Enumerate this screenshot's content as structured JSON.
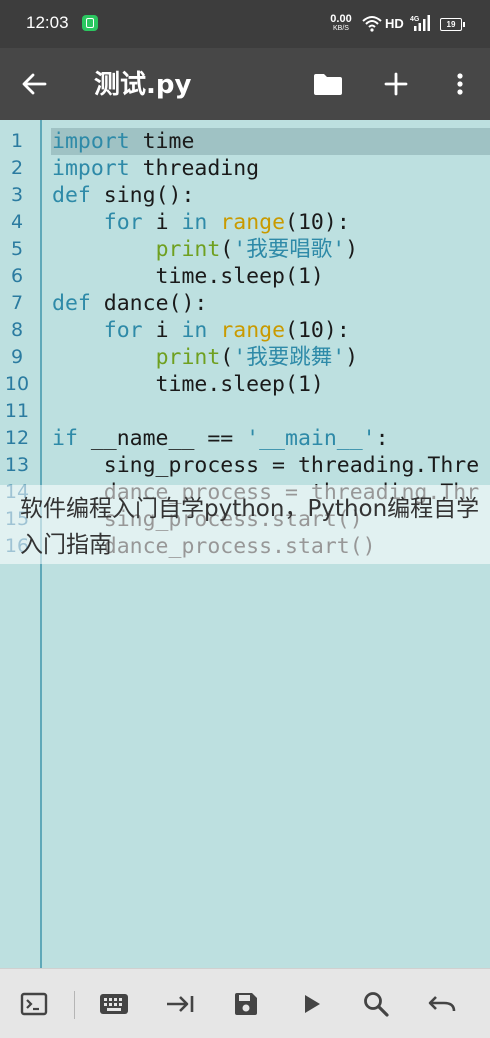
{
  "status_bar": {
    "time": "12:03",
    "net_speed_value": "0.00",
    "net_speed_unit": "KB/S",
    "network_type": "HD",
    "signal_label": "4G",
    "battery_level": "19"
  },
  "app_bar": {
    "title": "测试.py",
    "icons": [
      "back-arrow-icon",
      "folder-icon",
      "add-icon",
      "more-vert-icon"
    ]
  },
  "editor": {
    "current_line": 1,
    "lines": [
      {
        "n": "1",
        "code": "import time"
      },
      {
        "n": "2",
        "code": "import threading"
      },
      {
        "n": "3",
        "code": "def sing():"
      },
      {
        "n": "4",
        "code": "    for i in range(10):"
      },
      {
        "n": "5",
        "code": "        print('我要唱歌')"
      },
      {
        "n": "6",
        "code": "        time.sleep(1)"
      },
      {
        "n": "7",
        "code": "def dance():"
      },
      {
        "n": "8",
        "code": "    for i in range(10):"
      },
      {
        "n": "9",
        "code": "        print('我要跳舞')"
      },
      {
        "n": "10",
        "code": "        time.sleep(1)"
      },
      {
        "n": "11",
        "code": ""
      },
      {
        "n": "12",
        "code": "if __name__ == '__main__':"
      },
      {
        "n": "13",
        "code": "    sing_process = threading.Thre"
      },
      {
        "n": "14",
        "code": "    dance_process = threading.Thr"
      },
      {
        "n": "15",
        "code": "    sing_process.start()"
      },
      {
        "n": "16",
        "code": "    dance_process.start()"
      }
    ]
  },
  "watermark": {
    "text": "软件编程入门自学python，Python编程自学入门指南"
  },
  "toolbar": {
    "icons": [
      "terminal-icon",
      "keyboard-icon",
      "tab-indent-icon",
      "save-icon",
      "run-icon",
      "search-icon",
      "undo-icon"
    ]
  },
  "colors": {
    "status_bar": "#3d3d3d",
    "app_bar": "#474747",
    "editor_bg": "#bde0e0",
    "current_line": "#9fc2c4",
    "gutter_line": "#5fa8b8",
    "keyword": "#2e8aa8",
    "builtin": "#c99a00",
    "function_call": "#6fa020",
    "toolbar_bg": "#e6e6e6"
  }
}
